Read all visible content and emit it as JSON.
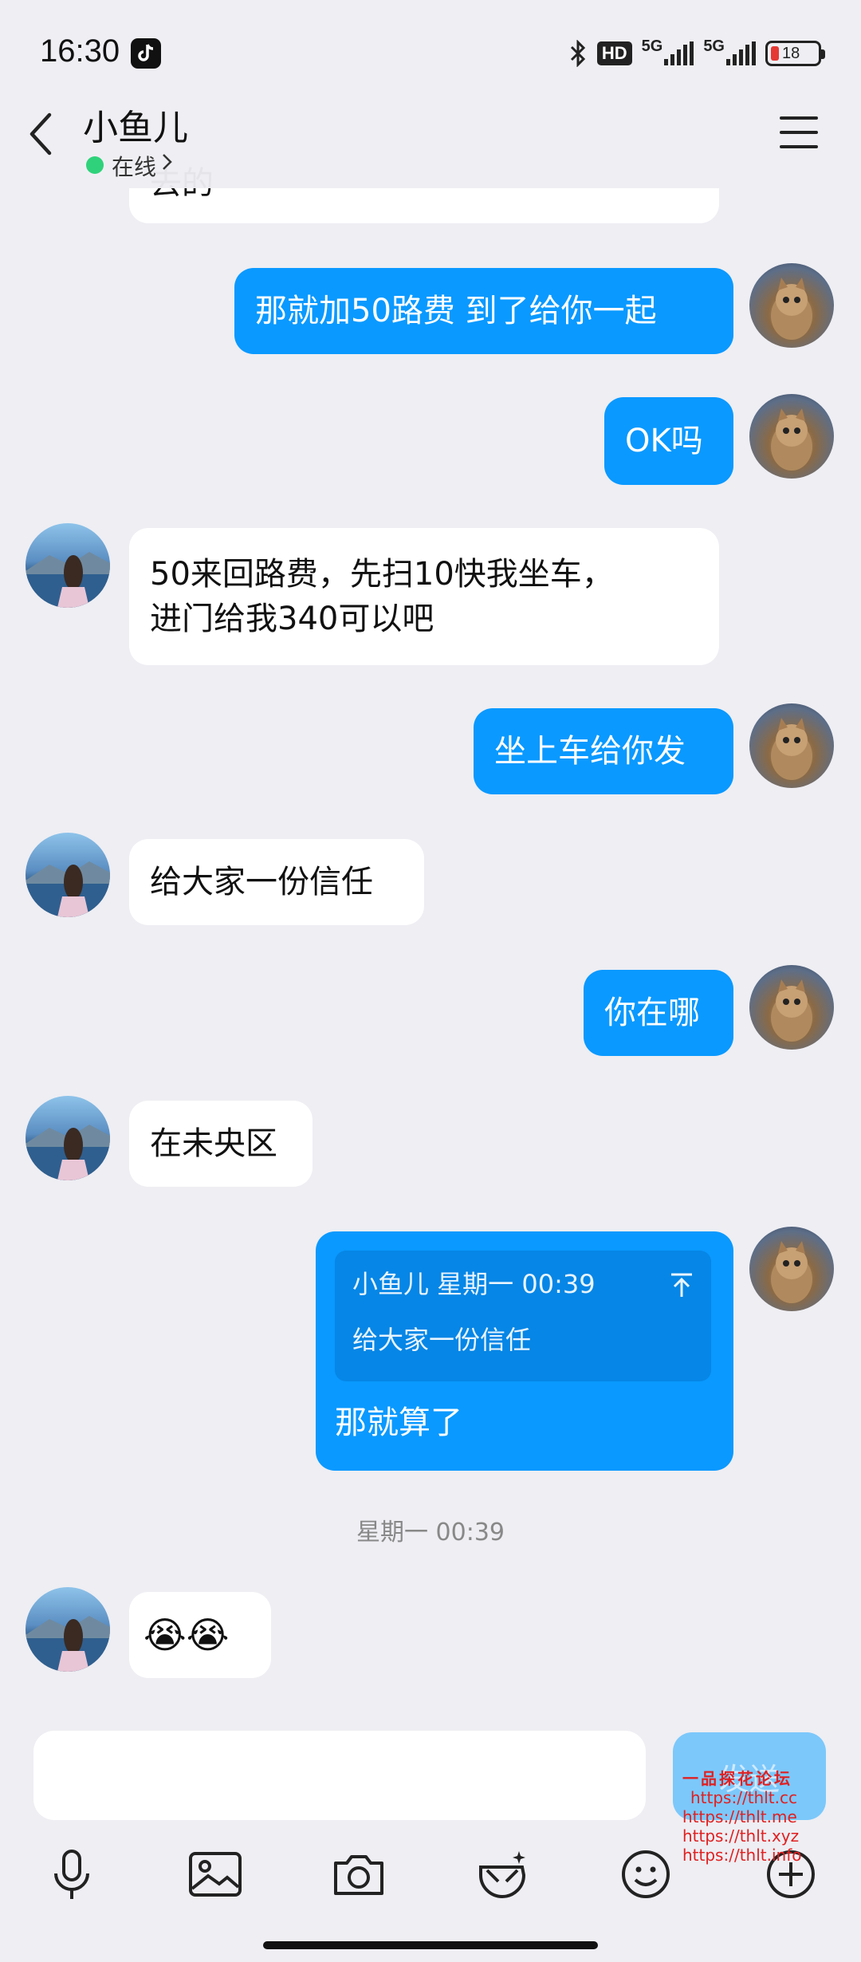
{
  "status_bar": {
    "time": "16:30",
    "hd": "HD",
    "network_1": "5G",
    "network_2": "5G",
    "battery": "18"
  },
  "header": {
    "contact_name": "小鱼儿",
    "status": "在线"
  },
  "messages": [
    {
      "side": "in",
      "text": "去的"
    },
    {
      "side": "out",
      "text": "那就加50路费 到了给你一起"
    },
    {
      "side": "out",
      "text": "OK吗"
    },
    {
      "side": "in",
      "text_line1": "50来回路费，先扫10快我坐车，",
      "text_line2": "进门给我340可以吧"
    },
    {
      "side": "out",
      "text": "坐上车给你发"
    },
    {
      "side": "in",
      "text": "给大家一份信任"
    },
    {
      "side": "out",
      "text": "你在哪"
    },
    {
      "side": "in",
      "text": "在未央区"
    },
    {
      "side": "out",
      "quote_header": "小鱼儿 星期一 00:39",
      "quote_text": "给大家一份信任",
      "text": "那就算了"
    },
    {
      "side": "in",
      "emoji": "😭😭"
    }
  ],
  "timestamp": "星期一 00:39",
  "input": {
    "placeholder": "",
    "send_label": "发送"
  },
  "toolbar": {
    "icons": [
      "microphone-icon",
      "image-icon",
      "camera-icon",
      "sticker-icon",
      "emoji-icon",
      "plus-icon"
    ]
  },
  "watermark": {
    "title": "一品探花论坛",
    "lines": [
      "https://thlt.cc",
      "https://thlt.me",
      "https://thlt.xyz",
      "https://thlt.info"
    ]
  },
  "colors": {
    "outgoing_bubble": "#0a99ff",
    "incoming_bubble": "#ffffff",
    "background": "#eeeef3",
    "online": "#2fd27a"
  }
}
